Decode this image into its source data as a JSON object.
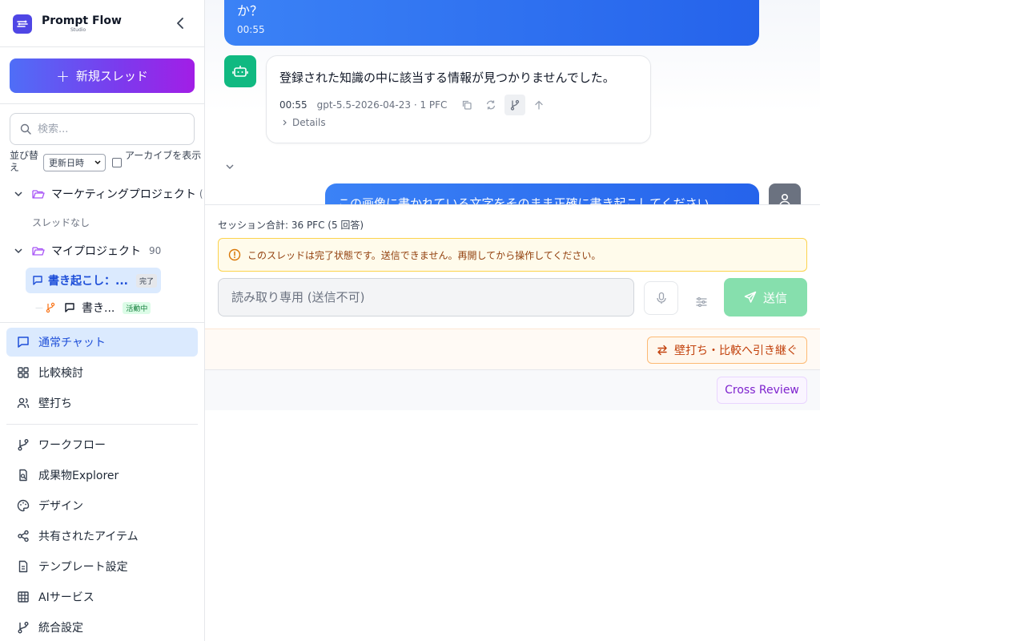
{
  "brand": {
    "name": "Prompt Flow",
    "subtitle": "Studio"
  },
  "sidebar": {
    "new_thread_label": "新規スレッド",
    "search_placeholder": "検索...",
    "sort_label": "並び替え",
    "sort_value": "更新日時",
    "archive_label": "アーカイブを表示",
    "archive_checked": false,
    "projects": [
      {
        "name": "マーケティングプロジェクト",
        "count": "(",
        "empty_note": "スレッドなし"
      },
      {
        "name": "マイプロジェクト",
        "count": "90",
        "threads": [
          {
            "title": "書き起こし：...",
            "badge": "完了",
            "active": true
          },
          {
            "title": "書き...",
            "badge": "活動中",
            "active": false
          }
        ]
      }
    ],
    "nav": [
      {
        "label": "通常チャット",
        "icon": "chat-icon",
        "active": true
      },
      {
        "label": "比較検討",
        "icon": "grid-icon"
      },
      {
        "label": "壁打ち",
        "icon": "users-icon"
      },
      {
        "label": "ワークフロー",
        "icon": "branch-icon"
      },
      {
        "label": "成果物Explorer",
        "icon": "file-search-icon"
      },
      {
        "label": "デザイン",
        "icon": "palette-icon"
      },
      {
        "label": "共有されたアイテム",
        "icon": "share-icon"
      },
      {
        "label": "テンプレート設定",
        "icon": "document-icon"
      },
      {
        "label": "AIサービス",
        "icon": "table-icon"
      },
      {
        "label": "統合設定",
        "icon": "branch-icon"
      }
    ]
  },
  "chat": {
    "messages": [
      {
        "role": "user",
        "text": "か？",
        "time": "00:55"
      },
      {
        "role": "assistant",
        "text": "登録された知識の中に該当する情報が見つかりませんでした。",
        "time": "00:55",
        "model": "gpt-5.5-2026-04-23 · 1 PFC",
        "details_label": "Details"
      },
      {
        "role": "user",
        "text": "この画像に書かれている文字をそのまま正確に書き起こしてください"
      }
    ],
    "session_total": "セッション合計: 36 PFC (5 回答)",
    "warning": "このスレッドは完了状態です。送信できません。再開してから操作してください。",
    "input_placeholder": "読み取り専用 (送信不可)",
    "send_label": "送信",
    "handoff_label": "壁打ち・比較へ引き継ぐ",
    "cross_review_label": "Cross Review"
  },
  "colors": {
    "accent": "#2563eb",
    "bot": "#10b981",
    "send_disabled": "#86dfad",
    "warning_bg": "#fffbeb",
    "handoff": "#c2410c",
    "review": "#7e22ce"
  }
}
